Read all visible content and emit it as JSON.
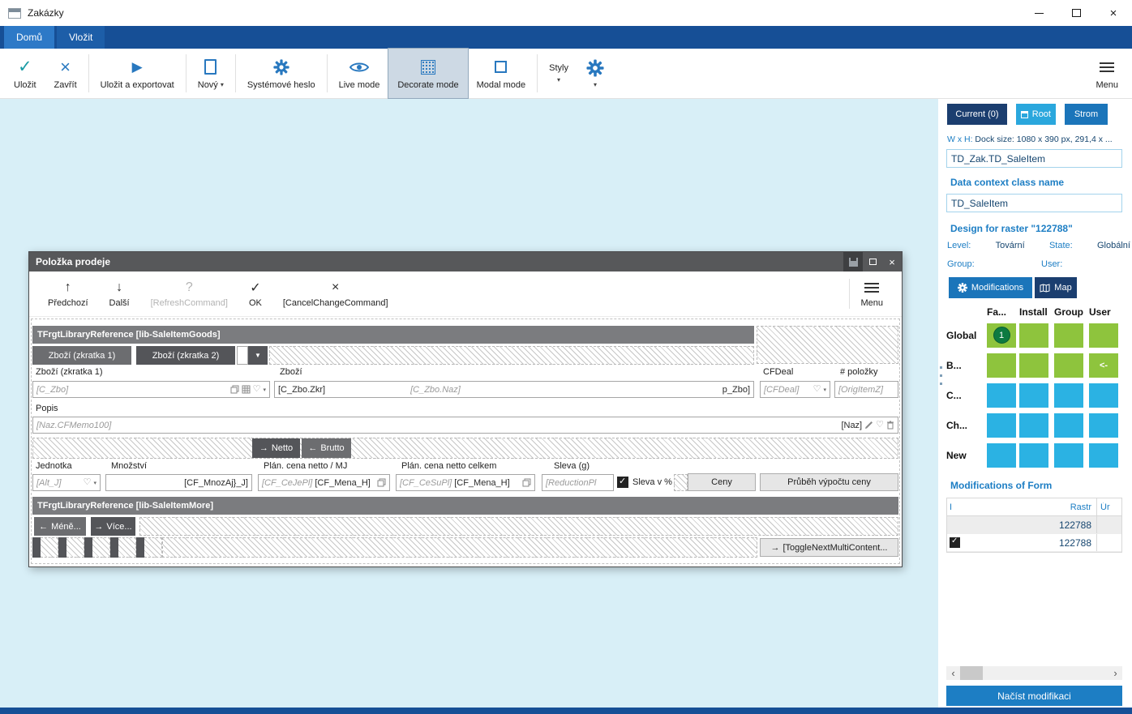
{
  "app": {
    "title": "Zakázky"
  },
  "icons": {
    "check": "✓",
    "close": "×",
    "play": "▶",
    "caret": "▼",
    "caret_small": "▾",
    "up": "↑",
    "down": "↓",
    "left": "←",
    "right": "→",
    "question": "?",
    "heart": "♡",
    "chev_left": "‹",
    "chev_right": "›"
  },
  "colors": {
    "accent_blue": "#1b75ba",
    "navy": "#1b3e6f",
    "cell_green": "#8ec43d",
    "cell_cyan": "#2bb2e3",
    "ribbon_blue": "#164f96",
    "canvas_cyan": "#d8eff7"
  },
  "ribbon": {
    "tab_home": "Domů",
    "tab_insert": "Vložit"
  },
  "toolbar": {
    "save": "Uložit",
    "close": "Zavřít",
    "save_export": "Uložit a exportovat",
    "new": "Nový",
    "system_password": "Systémové heslo",
    "live_mode": "Live mode",
    "decorate_mode": "Decorate mode",
    "modal_mode": "Modal mode",
    "styles": "Styly",
    "menu": "Menu"
  },
  "designer": {
    "title": "Položka prodeje",
    "toolbar": {
      "previous": "Předchozí",
      "next": "Další",
      "refresh": "[RefreshCommand]",
      "ok": "OK",
      "cancel": "[CancelChangeCommand]",
      "menu": "Menu"
    },
    "goods": {
      "header": "TFrgtLibraryReference [lib-SaleItemGoods]",
      "tab_short1": "Zboží (zkratka 1)",
      "tab_short2": "Zboží (zkratka 2)",
      "lbl_short1": "Zboží (zkratka 1)",
      "lbl_goods": "Zboží",
      "lbl_cfdeal": "CFDeal",
      "lbl_item_number": "# položky",
      "ph_code": "[C_Zbo]",
      "val_zkr": "[C_Zbo.Zkr]",
      "ph_naz": "[C_Zbo.Naz]",
      "val_disp": "p_Zbo]",
      "ph_cfdeal": "[CFDeal]",
      "ph_orig_item": "[OrigItemZ]",
      "lbl_popis": "Popis",
      "ph_memo": "[Naz.CFMemo100]",
      "val_naz": "[Naz]"
    },
    "price": {
      "btn_netto": "Netto",
      "btn_brutto": "Brutto",
      "lbl_unit": "Jednotka",
      "lbl_quantity": "Množství",
      "lbl_price_unit": "Plán. cena netto / MJ",
      "lbl_price_total": "Plán. cena netto celkem",
      "lbl_discount": "Sleva (g)",
      "ph_unit": "[Alt_J]",
      "val_quantity": "[CF_MnozAj}_J]",
      "ph_price_unit": "[CF_CeJePl]",
      "val_currency": "[CF_Mena_H]",
      "ph_price_total": "[CF_CeSuPl]",
      "ph_discount": "[ReductionPl",
      "chk_discount_pct": "Sleva v %",
      "btn_prices": "Ceny",
      "btn_price_progress": "Průběh výpočtu ceny"
    },
    "more": {
      "header": "TFrgtLibraryReference [lib-SaleItemMore]",
      "btn_less": "Méně...",
      "btn_more": "Více...",
      "btn_toggle": "[ToggleNextMultiContent..."
    }
  },
  "inspector": {
    "tab_current": "Current (0)",
    "tab_root": "Root",
    "tab_tree": "Strom",
    "wh_label": "W x H:",
    "wh_value": "Dock size: 1080 x 390 px, 291,4 x ...",
    "path_value": "TD_Zak.TD_SaleItem",
    "context_label": "Data context class name",
    "context_value": "TD_SaleItem",
    "raster_label": "Design for raster \"122788\"",
    "level_label": "Level:",
    "level_value": "Tovární",
    "state_label": "State:",
    "state_value": "Globální",
    "group_label": "Group:",
    "user_label": "User:",
    "tab_modifications": "Modifications",
    "tab_map": "Map",
    "grid": {
      "headers": [
        "Fa...",
        "Install",
        "Group",
        "User"
      ],
      "rows": [
        {
          "label": "Global",
          "cells": [
            "green",
            "green",
            "green",
            "green"
          ],
          "badge": "1"
        },
        {
          "label": "B...",
          "cells": [
            "green",
            "green",
            "green",
            "green"
          ],
          "arrow": "<-"
        },
        {
          "label": "C...",
          "cells": [
            "cyan",
            "cyan",
            "cyan",
            "cyan"
          ]
        },
        {
          "label": "Ch...",
          "cells": [
            "cyan",
            "cyan",
            "cyan",
            "cyan"
          ]
        },
        {
          "label": "New",
          "cells": [
            "cyan",
            "cyan",
            "cyan",
            "cyan"
          ]
        }
      ]
    },
    "mods_title": "Modifications of Form",
    "mods": {
      "col_i": "I",
      "col_rastr": "Rastr",
      "col_level": "Úr",
      "rows": [
        {
          "rastr": "122788",
          "state": "none"
        },
        {
          "rastr": "122788",
          "state": "checked"
        }
      ]
    },
    "load_button": "Načíst modifikaci"
  }
}
